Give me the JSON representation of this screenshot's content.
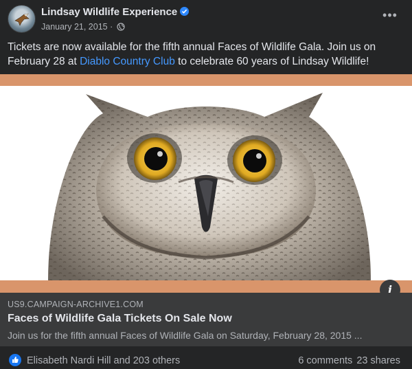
{
  "post": {
    "page_name": "Lindsay Wildlife Experience",
    "date": "January 21, 2015",
    "dot": " · ",
    "text_before_link": "Tickets are now available for the fifth annual Faces of Wildlife Gala. Join us on February 28 at ",
    "link_text": "Diablo Country Club",
    "text_after_link": " to celebrate 60 years of Lindsay Wildlife!",
    "more_label": "•••",
    "icons": {
      "verified": "verified-badge-icon",
      "audience": "globe-icon",
      "more": "more-options-icon"
    }
  },
  "link_preview": {
    "info_label": "i",
    "domain": "US9.CAMPAIGN-ARCHIVE1.COM",
    "title": "Faces of Wildlife Gala Tickets On Sale Now",
    "description": "Join us for the fifth annual Faces of Wildlife Gala on Saturday, February 28, 2015 ..."
  },
  "engagement": {
    "reactors": "Elisabeth Nardi Hill and 203 others",
    "comments": "6 comments",
    "shares": "23 shares",
    "reaction_icon": "like-icon"
  },
  "colors": {
    "background": "#242526",
    "link_blue": "#4599ff",
    "stripe": "#d9956b",
    "like_blue": "#1877f2",
    "card": "#3a3b3c"
  }
}
